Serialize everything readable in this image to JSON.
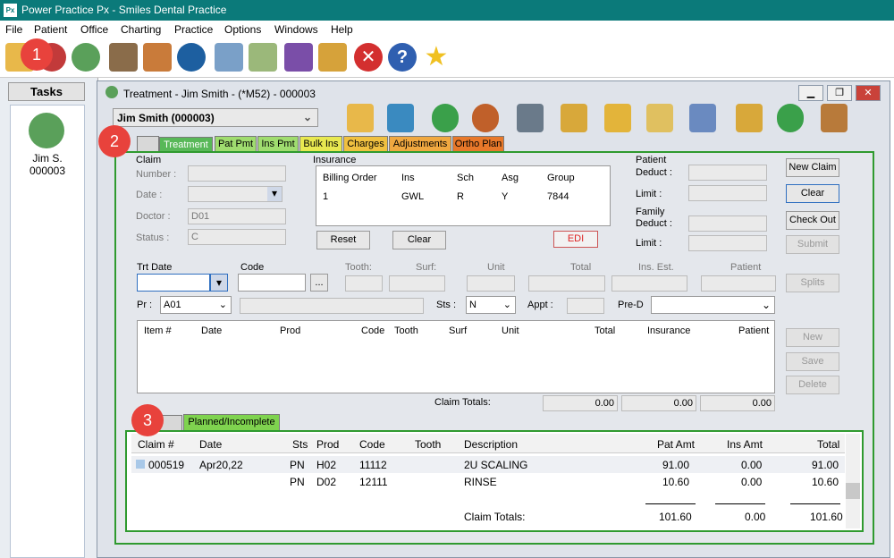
{
  "app": {
    "logo": "Px",
    "title": "Power Practice Px - Smiles Dental Practice"
  },
  "menu": [
    "File",
    "Patient",
    "Office",
    "Charting",
    "Practice",
    "Options",
    "Windows",
    "Help"
  ],
  "toolbar_icons": [
    "folder-icon",
    "star-red-icon",
    "money-icon",
    "book-icon",
    "chart-icon",
    "camera-icon",
    "mail-icon",
    "checklist-icon",
    "edi-icon",
    "gift-icon",
    "close-icon",
    "help-icon",
    "favorite-star-icon"
  ],
  "tasks": {
    "header": "Tasks",
    "patient_short": "Jim S.",
    "patient_id": "000003"
  },
  "window": {
    "title": "Treatment - Jim Smith - (*M52) - 000003",
    "min": "▁",
    "max": "❐",
    "close": "✕"
  },
  "patient_select": "Jim Smith (000003)",
  "tabs": [
    "Treatment",
    "Pat Pmt",
    "Ins Pmt",
    "Bulk Ins",
    "Charges",
    "Adjustments",
    "Ortho Plan"
  ],
  "claim": {
    "title": "Claim",
    "number": "Number :",
    "date": "Date :",
    "doctor": "Doctor :",
    "doctor_val": "D01",
    "status": "Status :",
    "status_val": "C"
  },
  "insurance": {
    "title": "Insurance",
    "headers": [
      "Billing Order",
      "Ins",
      "Sch",
      "Asg",
      "Group"
    ],
    "row": [
      "1",
      "GWL",
      "R",
      "Y",
      "7844"
    ],
    "reset": "Reset",
    "clear": "Clear",
    "edi": "EDI"
  },
  "patient_box": {
    "title": "Patient",
    "deduct": "Deduct :",
    "limit": "Limit :",
    "family": "Family",
    "fdeduct": "Deduct :",
    "flimit": "Limit :"
  },
  "right_btns": {
    "new_claim": "New Claim",
    "clear": "Clear",
    "check_out": "Check Out",
    "submit": "Submit",
    "splits": "Splits",
    "new": "New",
    "save": "Save",
    "delete": "Delete"
  },
  "entry": {
    "trt_date": "Trt Date",
    "code": "Code",
    "tooth": "Tooth:",
    "surf": "Surf:",
    "unit": "Unit",
    "total": "Total",
    "ins_est": "Ins. Est.",
    "patient": "Patient",
    "pr": "Pr :",
    "pr_val": "A01",
    "sts": "Sts :",
    "sts_val": "N",
    "appt": "Appt :",
    "pred": "Pre-D",
    "browse": "..."
  },
  "items": {
    "headers": [
      "Item #",
      "Date",
      "Prod",
      "Code",
      "Tooth",
      "Surf",
      "Unit",
      "Total",
      "Insurance",
      "Patient"
    ],
    "claim_totals": "Claim Totals:",
    "totals": [
      "0.00",
      "0.00",
      "0.00"
    ]
  },
  "bottom_tab": "Planned/Incomplete",
  "planned": {
    "headers": [
      "Claim #",
      "Date",
      "Sts",
      "Prod",
      "Code",
      "Tooth",
      "Description",
      "Pat Amt",
      "Ins Amt",
      "Total"
    ],
    "rows": [
      [
        "000519",
        "Apr20,22",
        "PN",
        "H02",
        "11112",
        "",
        "2U SCALING",
        "91.00",
        "0.00",
        "91.00"
      ],
      [
        "",
        "",
        "PN",
        "D02",
        "12111",
        "",
        "RINSE",
        "10.60",
        "0.00",
        "10.60"
      ]
    ],
    "totals_label": "Claim Totals:",
    "totals": [
      "101.60",
      "0.00",
      "101.60"
    ]
  },
  "annotations": [
    "1",
    "2",
    "3"
  ]
}
